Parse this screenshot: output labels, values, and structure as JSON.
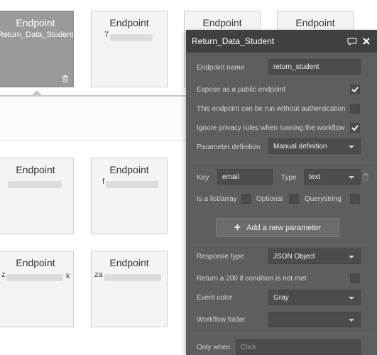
{
  "cards": [
    {
      "title": "Endpoint",
      "subtitle": "Return_Data_Student"
    },
    {
      "title": "Endpoint",
      "subtitle": "7"
    },
    {
      "title": "Endpoint",
      "subtitle": ""
    },
    {
      "title": "Endpoint",
      "subtitle": ""
    },
    {
      "title": "Endpoint",
      "subtitle": ""
    },
    {
      "title": "Endpoint",
      "subtitle": "f"
    },
    {
      "title": "Endpoint",
      "subtitle": "z",
      "subtitle_end": "k"
    },
    {
      "title": "Endpoint",
      "subtitle": "za"
    }
  ],
  "panel": {
    "title": "Return_Data_Student",
    "endpoint_name_label": "Endpoint name",
    "endpoint_name_value": "return_student",
    "expose_label": "Expose as a public endpoint",
    "expose_checked": true,
    "no_auth_label": "This endpoint can be run without authentication",
    "no_auth_checked": false,
    "ignore_privacy_label": "Ignore privacy rules when running the workflow",
    "ignore_privacy_checked": true,
    "param_def_label": "Parameter definition",
    "param_def_value": "Manual definition",
    "key_label": "Key",
    "key_value": "email",
    "type_label": "Type",
    "type_value": "text",
    "is_list_label": "Is a list/array",
    "optional_label": "Optional",
    "querystring_label": "Querystring",
    "add_param_label": "Add a new parameter",
    "response_type_label": "Response type",
    "response_type_value": "JSON Object",
    "return200_label": "Return a 200 if condition is not met",
    "event_color_label": "Event color",
    "event_color_value": "Gray",
    "workflow_folder_label": "Workflow folder",
    "workflow_folder_value": "",
    "only_when_label": "Only when",
    "only_when_placeholder": "Click"
  }
}
